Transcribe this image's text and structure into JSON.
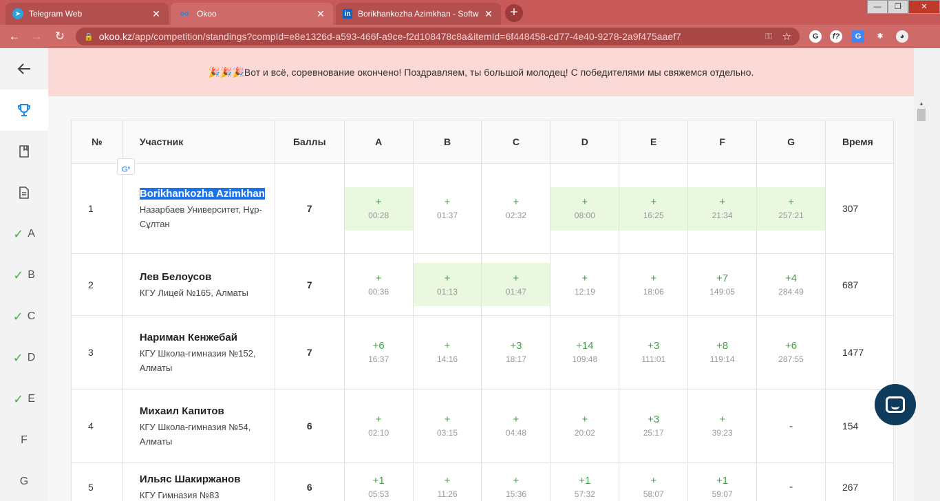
{
  "browser": {
    "tabs": [
      {
        "title": "Telegram Web",
        "icon": "telegram-icon",
        "active": false
      },
      {
        "title": "Okoo",
        "icon": "okoo-icon",
        "active": true
      },
      {
        "title": "Borikhankozha Azimkhan - Softw",
        "icon": "linkedin-icon",
        "active": false
      }
    ],
    "url_host": "okoo.kz",
    "url_path": "/app/competition/standings?compId=e8e1326d-a593-466f-a9ce-f2d108478c8a&itemId=6f448458-cd77-4e40-9278-2a9f475aaef7"
  },
  "banner": {
    "text": "🎉🎉🎉Вот и всё, соревнование окончено! Поздравляем, ты большой молодец! С победителями мы свяжемся отдельно."
  },
  "sidebar": {
    "items": [
      {
        "label": "A",
        "solved": true
      },
      {
        "label": "B",
        "solved": true
      },
      {
        "label": "C",
        "solved": true
      },
      {
        "label": "D",
        "solved": true
      },
      {
        "label": "E",
        "solved": true
      },
      {
        "label": "F",
        "solved": false
      },
      {
        "label": "G",
        "solved": false
      }
    ]
  },
  "table": {
    "headers": {
      "num": "№",
      "participant": "Участник",
      "score": "Баллы",
      "problems": [
        "A",
        "B",
        "C",
        "D",
        "E",
        "F",
        "G"
      ],
      "time": "Время"
    },
    "rows": [
      {
        "rank": "1",
        "name": "Borikhankozha Azimkhan",
        "school": "Назарбаев Университет, Нұр-Сұлтан",
        "score": "7",
        "time": "307",
        "cells": [
          {
            "mark": "+",
            "time": "00:28",
            "solved_first": true
          },
          {
            "mark": "+",
            "time": "01:37",
            "solved_first": false
          },
          {
            "mark": "+",
            "time": "02:32",
            "solved_first": false
          },
          {
            "mark": "+",
            "time": "08:00",
            "solved_first": true
          },
          {
            "mark": "+",
            "time": "16:25",
            "solved_first": true
          },
          {
            "mark": "+",
            "time": "21:34",
            "solved_first": true
          },
          {
            "mark": "+",
            "time": "257:21",
            "solved_first": true
          }
        ]
      },
      {
        "rank": "2",
        "name": "Лев Белоусов",
        "school": "КГУ Лицей №165, Алматы",
        "score": "7",
        "time": "687",
        "cells": [
          {
            "mark": "+",
            "time": "00:36",
            "solved_first": false
          },
          {
            "mark": "+",
            "time": "01:13",
            "solved_first": true
          },
          {
            "mark": "+",
            "time": "01:47",
            "solved_first": true
          },
          {
            "mark": "+",
            "time": "12:19",
            "solved_first": false
          },
          {
            "mark": "+",
            "time": "18:06",
            "solved_first": false
          },
          {
            "mark": "+7",
            "time": "149:05",
            "solved_first": false
          },
          {
            "mark": "+4",
            "time": "284:49",
            "solved_first": false
          }
        ]
      },
      {
        "rank": "3",
        "name": "Нариман Кенжебай",
        "school": "КГУ Школа-гимназия №152, Алматы",
        "score": "7",
        "time": "1477",
        "cells": [
          {
            "mark": "+6",
            "time": "16:37",
            "solved_first": false
          },
          {
            "mark": "+",
            "time": "14:16",
            "solved_first": false
          },
          {
            "mark": "+3",
            "time": "18:17",
            "solved_first": false
          },
          {
            "mark": "+14",
            "time": "109:48",
            "solved_first": false
          },
          {
            "mark": "+3",
            "time": "111:01",
            "solved_first": false
          },
          {
            "mark": "+8",
            "time": "119:14",
            "solved_first": false
          },
          {
            "mark": "+6",
            "time": "287:55",
            "solved_first": false
          }
        ]
      },
      {
        "rank": "4",
        "name": "Михаил Капитов",
        "school": "КГУ Школа-гимназия №54, Алматы",
        "score": "6",
        "time": "154",
        "cells": [
          {
            "mark": "+",
            "time": "02:10",
            "solved_first": false
          },
          {
            "mark": "+",
            "time": "03:15",
            "solved_first": false
          },
          {
            "mark": "+",
            "time": "04:48",
            "solved_first": false
          },
          {
            "mark": "+",
            "time": "20:02",
            "solved_first": false
          },
          {
            "mark": "+3",
            "time": "25:17",
            "solved_first": false
          },
          {
            "mark": "+",
            "time": "39:23",
            "solved_first": false
          },
          {
            "mark": "-",
            "time": "",
            "solved_first": false
          }
        ]
      },
      {
        "rank": "5",
        "name": "Ильяс Шакиржанов",
        "school": "КГУ Гимназия №83",
        "score": "6",
        "time": "267",
        "cells": [
          {
            "mark": "+1",
            "time": "05:53",
            "solved_first": false
          },
          {
            "mark": "+",
            "time": "11:26",
            "solved_first": false
          },
          {
            "mark": "+",
            "time": "15:36",
            "solved_first": false
          },
          {
            "mark": "+1",
            "time": "57:32",
            "solved_first": false
          },
          {
            "mark": "+",
            "time": "58:07",
            "solved_first": false
          },
          {
            "mark": "+1",
            "time": "59:07",
            "solved_first": false
          },
          {
            "mark": "-",
            "time": "",
            "solved_first": false
          }
        ]
      }
    ]
  },
  "colors": {
    "tabbar": "#c75a59",
    "toolbar": "#ce6a68",
    "banner": "#fbd9d6",
    "solved_first_bg": "#eaf8e0",
    "accepted": "#43a047",
    "chat": "#0f3b5c"
  }
}
